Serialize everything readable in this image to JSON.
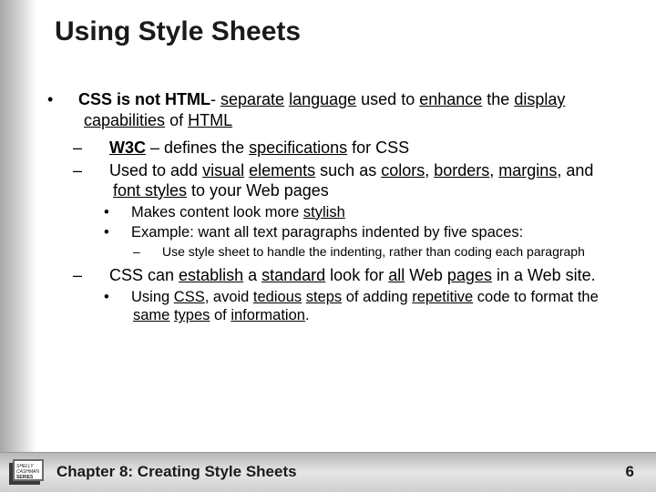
{
  "slide": {
    "title": "Using Style Sheets",
    "bullets": {
      "b1_prefix": "CSS is not HTML",
      "b1_rest": "- separate language used to enhance the display capabilities of HTML",
      "b1_1_a": "W3C",
      "b1_1_b": " – defines the specifications for CSS",
      "b1_2": "Used to add visual elements such as colors, borders, margins, and font styles to your Web pages",
      "b1_2_1": "Makes content look more stylish",
      "b1_2_2": "Example: want all text paragraphs indented by five spaces:",
      "b1_2_2_1": "Use style sheet to handle the indenting, rather than coding each paragraph",
      "b1_3": "CSS can establish a standard look for all Web pages in a Web site.",
      "b1_3_1": "Using CSS, avoid tedious steps of adding repetitive code to format the same types of information."
    }
  },
  "footer": {
    "chapter": "Chapter 8: Creating Style Sheets",
    "page": "6",
    "logo_label": "Shelly Cashman Series"
  }
}
